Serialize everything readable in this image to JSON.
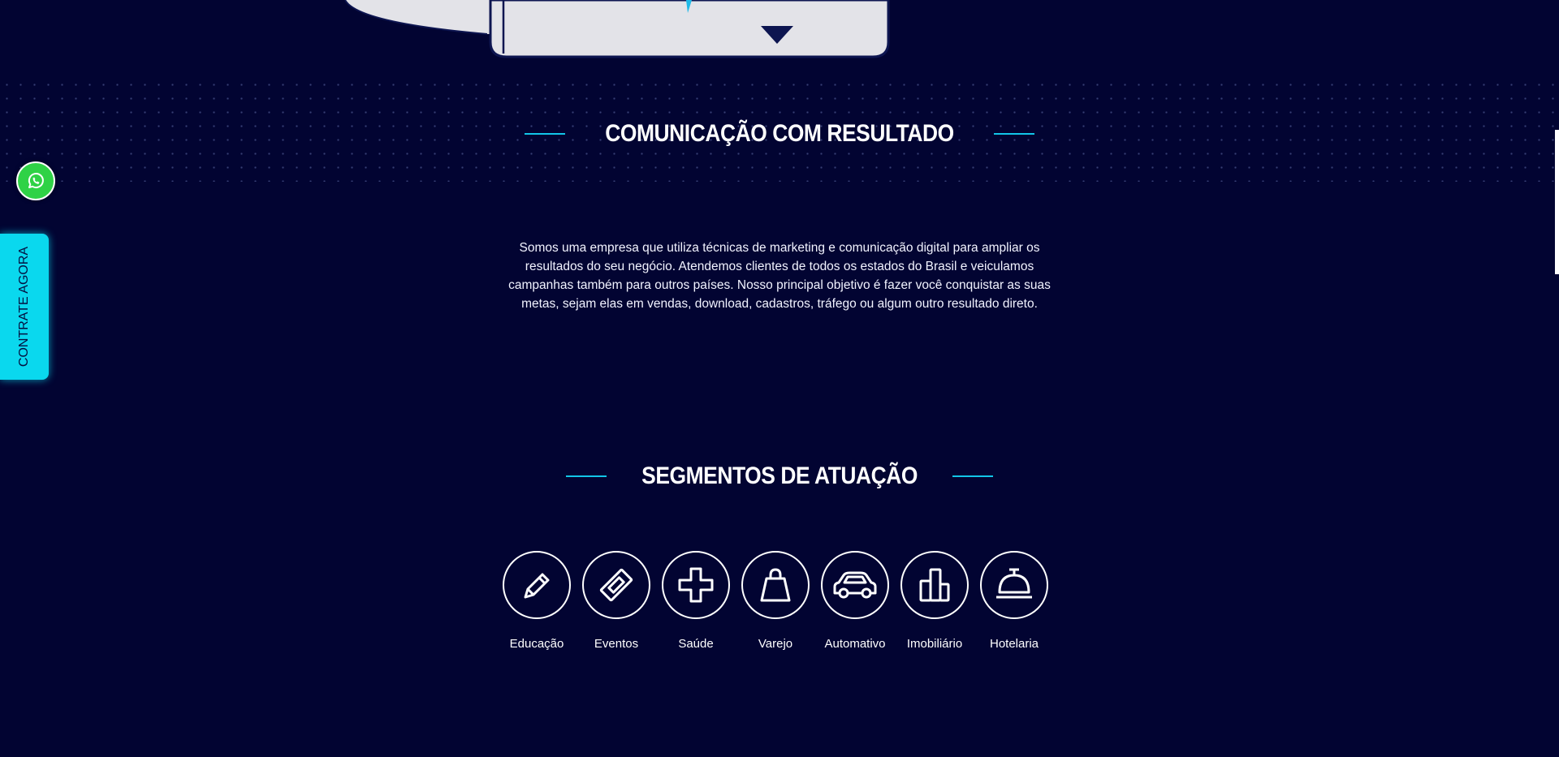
{
  "about": {
    "title": "COMUNICAÇÃO COM RESULTADO",
    "text": "Somos uma empresa que utiliza técnicas de marketing e comunicação digital para ampliar os resultados do seu negócio. Atendemos clientes de todos os estados do Brasil e veiculamos campanhas também para outros países. Nosso principal objetivo é fazer você conquistar as suas metas, sejam elas em vendas, download, cadastros, tráfego ou algum outro resultado direto."
  },
  "segments": {
    "title": "SEGMENTOS DE ATUAÇÃO",
    "items": [
      {
        "label": "Educação",
        "icon": "pencil-icon"
      },
      {
        "label": "Eventos",
        "icon": "ticket-icon"
      },
      {
        "label": "Saúde",
        "icon": "medical-cross-icon"
      },
      {
        "label": "Varejo",
        "icon": "shopping-bag-icon"
      },
      {
        "label": "Automativo",
        "icon": "car-icon"
      },
      {
        "label": "Imobiliário",
        "icon": "buildings-icon"
      },
      {
        "label": "Hotelaria",
        "icon": "service-bell-icon"
      }
    ]
  },
  "floating": {
    "cta_label": "CONTRATE AGORA",
    "whatsapp_icon": "whatsapp-icon"
  },
  "colors": {
    "background": "#020432",
    "accent": "#12c6e8",
    "cta": "#0ad8ee",
    "whatsapp": "#2fd246"
  }
}
